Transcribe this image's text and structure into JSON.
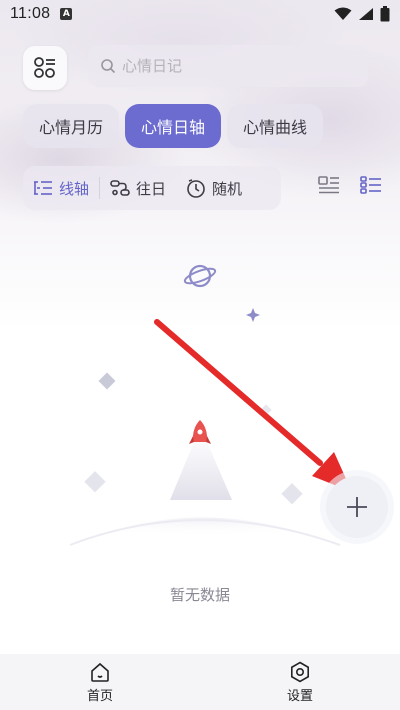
{
  "status": {
    "time": "11:08",
    "notif_badge": "A"
  },
  "search": {
    "placeholder": "心情日记"
  },
  "tabs": [
    {
      "label": "心情月历",
      "active": false
    },
    {
      "label": "心情日轴",
      "active": true
    },
    {
      "label": "心情曲线",
      "active": false
    }
  ],
  "views": [
    {
      "label": "线轴",
      "icon": "timeline-icon",
      "active": true
    },
    {
      "label": "往日",
      "icon": "history-icon",
      "active": false
    },
    {
      "label": "随机",
      "icon": "clock-icon",
      "active": false
    }
  ],
  "empty_text": "暂无数据",
  "nav": [
    {
      "label": "首页",
      "icon": "home-icon"
    },
    {
      "label": "设置",
      "icon": "gear-icon"
    }
  ],
  "colors": {
    "accent": "#6b6bd0",
    "arrow": "#e52a2a"
  }
}
